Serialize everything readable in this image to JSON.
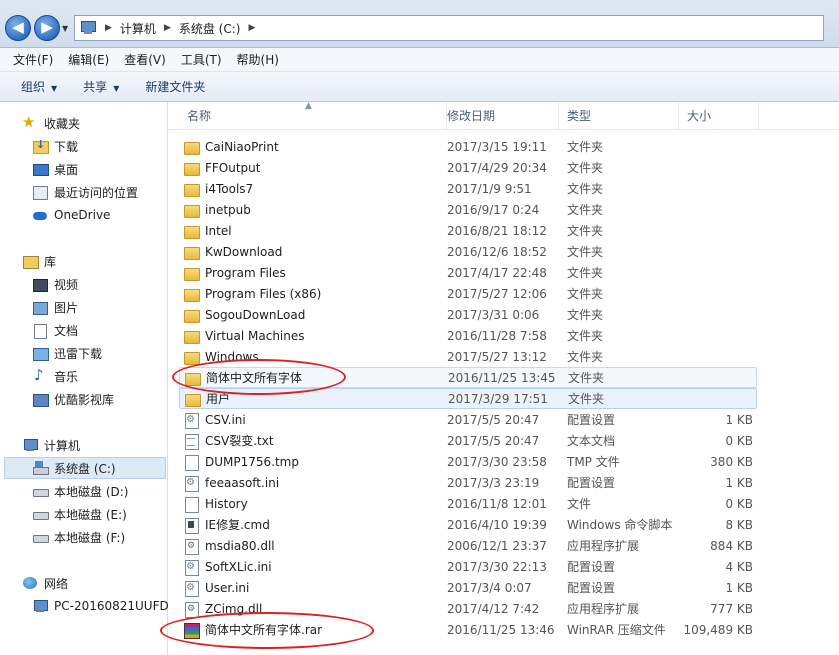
{
  "address": {
    "crumbs": [
      "计算机",
      "系统盘 (C:)"
    ]
  },
  "menu": [
    "文件(F)",
    "编辑(E)",
    "查看(V)",
    "工具(T)",
    "帮助(H)"
  ],
  "toolbar": {
    "organize": "组织",
    "share": "共享",
    "new_folder": "新建文件夹"
  },
  "nav": {
    "favorites": "收藏夹",
    "downloads": "下载",
    "desktop": "桌面",
    "recent": "最近访问的位置",
    "onedrive": "OneDrive",
    "library": "库",
    "videos": "视频",
    "pictures": "图片",
    "documents": "文档",
    "xunlei": "迅雷下载",
    "music": "音乐",
    "youku": "优酷影视库",
    "computer": "计算机",
    "drive_c": "系统盘 (C:)",
    "drive_d": "本地磁盘 (D:)",
    "drive_e": "本地磁盘 (E:)",
    "drive_f": "本地磁盘 (F:)",
    "network": "网络",
    "pc_name": "PC-20160821UUFD"
  },
  "columns": {
    "name": "名称",
    "date": "修改日期",
    "type": "类型",
    "size": "大小"
  },
  "files": [
    {
      "name": "CaiNiaoPrint",
      "date": "2017/3/15 19:11",
      "type": "文件夹",
      "size": "",
      "icon": "folder"
    },
    {
      "name": "FFOutput",
      "date": "2017/4/29 20:34",
      "type": "文件夹",
      "size": "",
      "icon": "folder"
    },
    {
      "name": "i4Tools7",
      "date": "2017/1/9 9:51",
      "type": "文件夹",
      "size": "",
      "icon": "folder"
    },
    {
      "name": "inetpub",
      "date": "2016/9/17 0:24",
      "type": "文件夹",
      "size": "",
      "icon": "folder"
    },
    {
      "name": "Intel",
      "date": "2016/8/21 18:12",
      "type": "文件夹",
      "size": "",
      "icon": "folder"
    },
    {
      "name": "KwDownload",
      "date": "2016/12/6 18:52",
      "type": "文件夹",
      "size": "",
      "icon": "folder"
    },
    {
      "name": "Program Files",
      "date": "2017/4/17 22:48",
      "type": "文件夹",
      "size": "",
      "icon": "folder"
    },
    {
      "name": "Program Files (x86)",
      "date": "2017/5/27 12:06",
      "type": "文件夹",
      "size": "",
      "icon": "folder"
    },
    {
      "name": "SogouDownLoad",
      "date": "2017/3/31 0:06",
      "type": "文件夹",
      "size": "",
      "icon": "folder"
    },
    {
      "name": "Virtual Machines",
      "date": "2016/11/28 7:58",
      "type": "文件夹",
      "size": "",
      "icon": "folder"
    },
    {
      "name": "Windows",
      "date": "2017/5/27 13:12",
      "type": "文件夹",
      "size": "",
      "icon": "folder"
    },
    {
      "name": "简体中文所有字体",
      "date": "2016/11/25 13:45",
      "type": "文件夹",
      "size": "",
      "icon": "folder"
    },
    {
      "name": "用户",
      "date": "2017/3/29 17:51",
      "type": "文件夹",
      "size": "",
      "icon": "folder"
    },
    {
      "name": "CSV.ini",
      "date": "2017/5/5 20:47",
      "type": "配置设置",
      "size": "1 KB",
      "icon": "ini"
    },
    {
      "name": "CSV裂变.txt",
      "date": "2017/5/5 20:47",
      "type": "文本文档",
      "size": "0 KB",
      "icon": "txt"
    },
    {
      "name": "DUMP1756.tmp",
      "date": "2017/3/30 23:58",
      "type": "TMP 文件",
      "size": "380 KB",
      "icon": "blank"
    },
    {
      "name": "feeaasoft.ini",
      "date": "2017/3/3 23:19",
      "type": "配置设置",
      "size": "1 KB",
      "icon": "ini"
    },
    {
      "name": "History",
      "date": "2016/11/8 12:01",
      "type": "文件",
      "size": "0 KB",
      "icon": "blank"
    },
    {
      "name": "IE修复.cmd",
      "date": "2016/4/10 19:39",
      "type": "Windows 命令脚本",
      "size": "8 KB",
      "icon": "cmd"
    },
    {
      "name": "msdia80.dll",
      "date": "2006/12/1 23:37",
      "type": "应用程序扩展",
      "size": "884 KB",
      "icon": "dll"
    },
    {
      "name": "SoftXLic.ini",
      "date": "2017/3/30 22:13",
      "type": "配置设置",
      "size": "4 KB",
      "icon": "ini"
    },
    {
      "name": "User.ini",
      "date": "2017/3/4 0:07",
      "type": "配置设置",
      "size": "1 KB",
      "icon": "ini"
    },
    {
      "name": "ZCimg.dll",
      "date": "2017/4/12 7:42",
      "type": "应用程序扩展",
      "size": "777 KB",
      "icon": "dll"
    },
    {
      "name": "简体中文所有字体.rar",
      "date": "2016/11/25 13:46",
      "type": "WinRAR 压缩文件",
      "size": "109,489 KB",
      "icon": "rar"
    }
  ],
  "colors": {
    "annotation": "#e02020",
    "selection": "#e9f2fd",
    "accent": "#2f6fc4"
  }
}
